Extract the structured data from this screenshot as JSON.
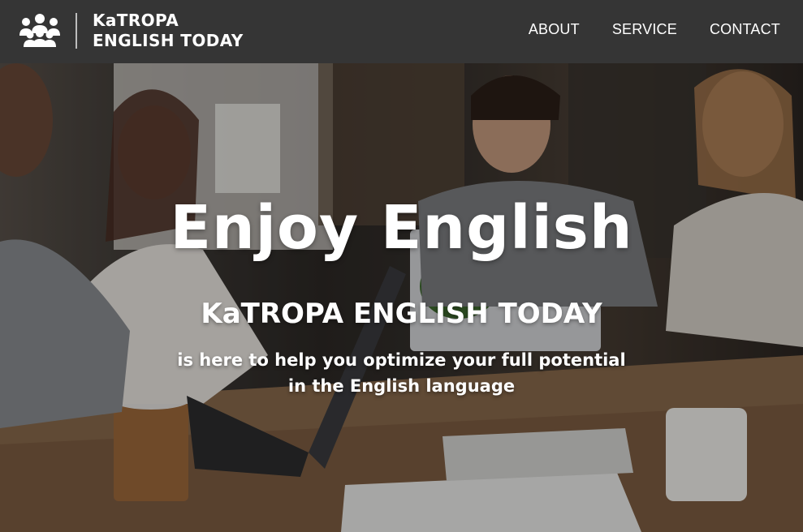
{
  "header": {
    "logo_line1": "KaTROPA",
    "logo_line2": "ENGLISH TODAY",
    "logo_icon": "people-group-icon",
    "nav": {
      "about": "ABOUT",
      "service": "SERVICE",
      "contact": "CONTACT"
    },
    "background_color": "#353535"
  },
  "hero": {
    "title": "Enjoy English",
    "subtitle": "KaTROPA ENGLISH TODAY",
    "description_line1": "is here to help you optimize your full potential",
    "description_line2": "in the English language",
    "background_image": "team-meeting-photo"
  }
}
